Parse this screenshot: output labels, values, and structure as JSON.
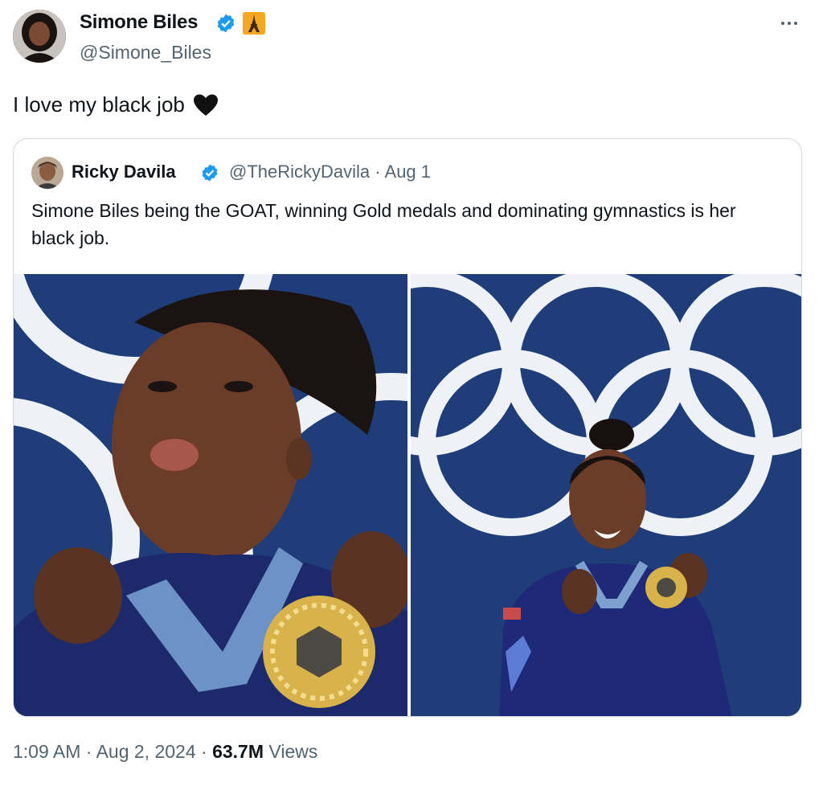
{
  "tweet": {
    "author": {
      "name": "Simone Biles",
      "handle": "@Simone_Biles"
    },
    "text": "I love my black job",
    "time": "1:09 AM",
    "date": "Aug 2, 2024",
    "views_count": "63.7M",
    "views_label": "Views"
  },
  "quote": {
    "author": {
      "name": "Ricky Davila",
      "handle": "@TheRickyDavila",
      "date": "Aug 1"
    },
    "text": "Simone Biles being the GOAT, winning Gold medals and dominating gymnastics is her black job."
  },
  "colors": {
    "verified_blue": "#1d9bf0",
    "background_blue": "#1f3d78",
    "ring_white": "#eef2f7",
    "medal_gold": "#d8b24a"
  },
  "icons": {
    "verified": "verified-badge-icon",
    "affiliate": "eiffel-tower-icon",
    "more": "more-horizontal-icon",
    "heart": "black-heart-icon"
  }
}
